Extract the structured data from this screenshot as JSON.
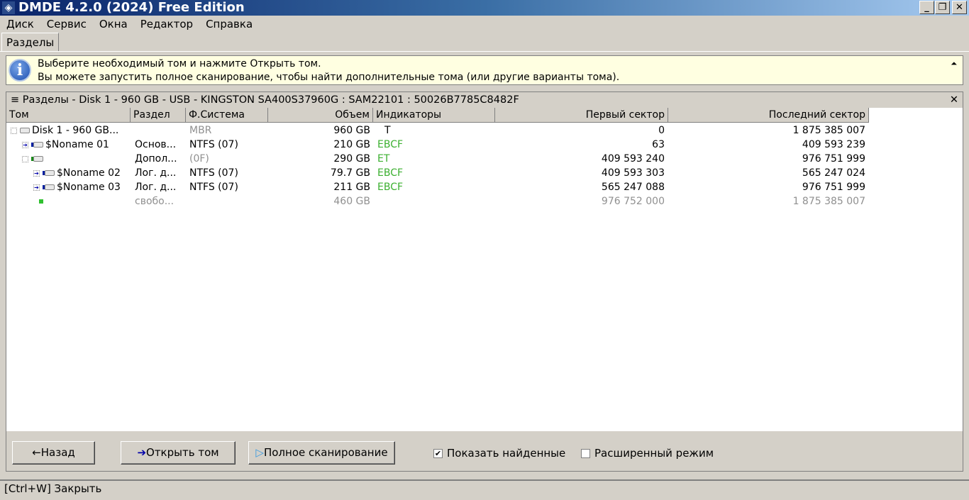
{
  "window": {
    "title": "DMDE 4.2.0 (2024) Free Edition"
  },
  "menu": [
    "Диск",
    "Сервис",
    "Окна",
    "Редактор",
    "Справка"
  ],
  "tab": "Разделы",
  "info": {
    "line1": "Выберите необходимый том и нажмите Открыть том.",
    "line2": "Вы можете запустить полное сканирование, чтобы найти дополнительные тома (или другие варианты тома)."
  },
  "panel": {
    "title": "Разделы - Disk 1 - 960 GB - USB - KINGSTON SA400S37960G : SAM22101 : 50026B7785C8482F"
  },
  "columns": [
    "Том",
    "Раздел",
    "Ф.Система",
    "Объем",
    "Индикаторы",
    "Первый сектор",
    "Последний сектор"
  ],
  "rows": [
    {
      "name": "Disk 1 - 960 GB...",
      "part": "",
      "fs": "MBR",
      "size": "960 GB",
      "ind": "T",
      "first": "0",
      "last": "1 875 385 007"
    },
    {
      "name": "$Noname 01",
      "part": "Основ...",
      "fs": "NTFS (07)",
      "size": "210 GB",
      "ind": "EBCF",
      "first": "63",
      "last": "409 593 239"
    },
    {
      "name": "",
      "part": "Допол...",
      "fs": "(0F)",
      "size": "290 GB",
      "ind": "ET",
      "first": "409 593 240",
      "last": "976 751 999"
    },
    {
      "name": "$Noname 02",
      "part": "Лог. д...",
      "fs": "NTFS (07)",
      "size": "79.7 GB",
      "ind": "EBCF",
      "first": "409 593 303",
      "last": "565 247 024"
    },
    {
      "name": "$Noname 03",
      "part": "Лог. д...",
      "fs": "NTFS (07)",
      "size": "211 GB",
      "ind": "EBCF",
      "first": "565 247 088",
      "last": "976 751 999"
    },
    {
      "name": "",
      "part": "свобо...",
      "fs": "",
      "size": "460 GB",
      "ind": "",
      "first": "976 752 000",
      "last": "1 875 385 007"
    }
  ],
  "buttons": {
    "back": "Назад",
    "open": "Открыть том",
    "scan": "Полное сканирование"
  },
  "checks": {
    "show_found": "Показать найденные",
    "show_found_checked": true,
    "advanced": "Расширенный режим",
    "advanced_checked": false
  },
  "status": "[Ctrl+W] Закрыть"
}
